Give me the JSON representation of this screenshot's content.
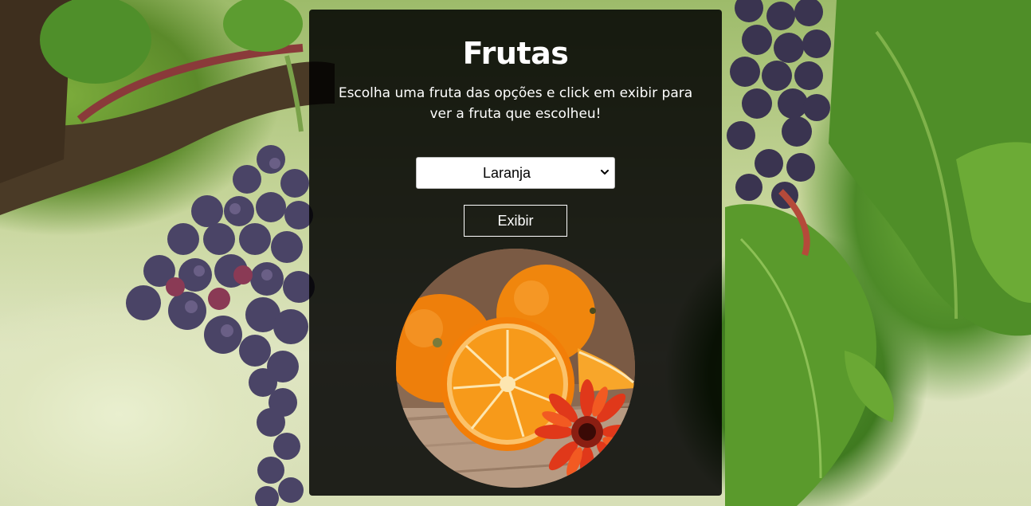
{
  "page": {
    "title": "Frutas",
    "subtitle": "Escolha uma fruta das opções e click em exibir para ver a fruta que escolheu!"
  },
  "select": {
    "selected": "Laranja",
    "icon": "chevron-down-icon"
  },
  "button": {
    "label": "Exibir"
  },
  "image": {
    "subject": "orange",
    "icon": "fruit-image"
  },
  "colors": {
    "panel_bg": "#000000",
    "text": "#ffffff",
    "orange": "#f68a12",
    "grape": "#3b3550",
    "leaf": "#5b9a30"
  }
}
